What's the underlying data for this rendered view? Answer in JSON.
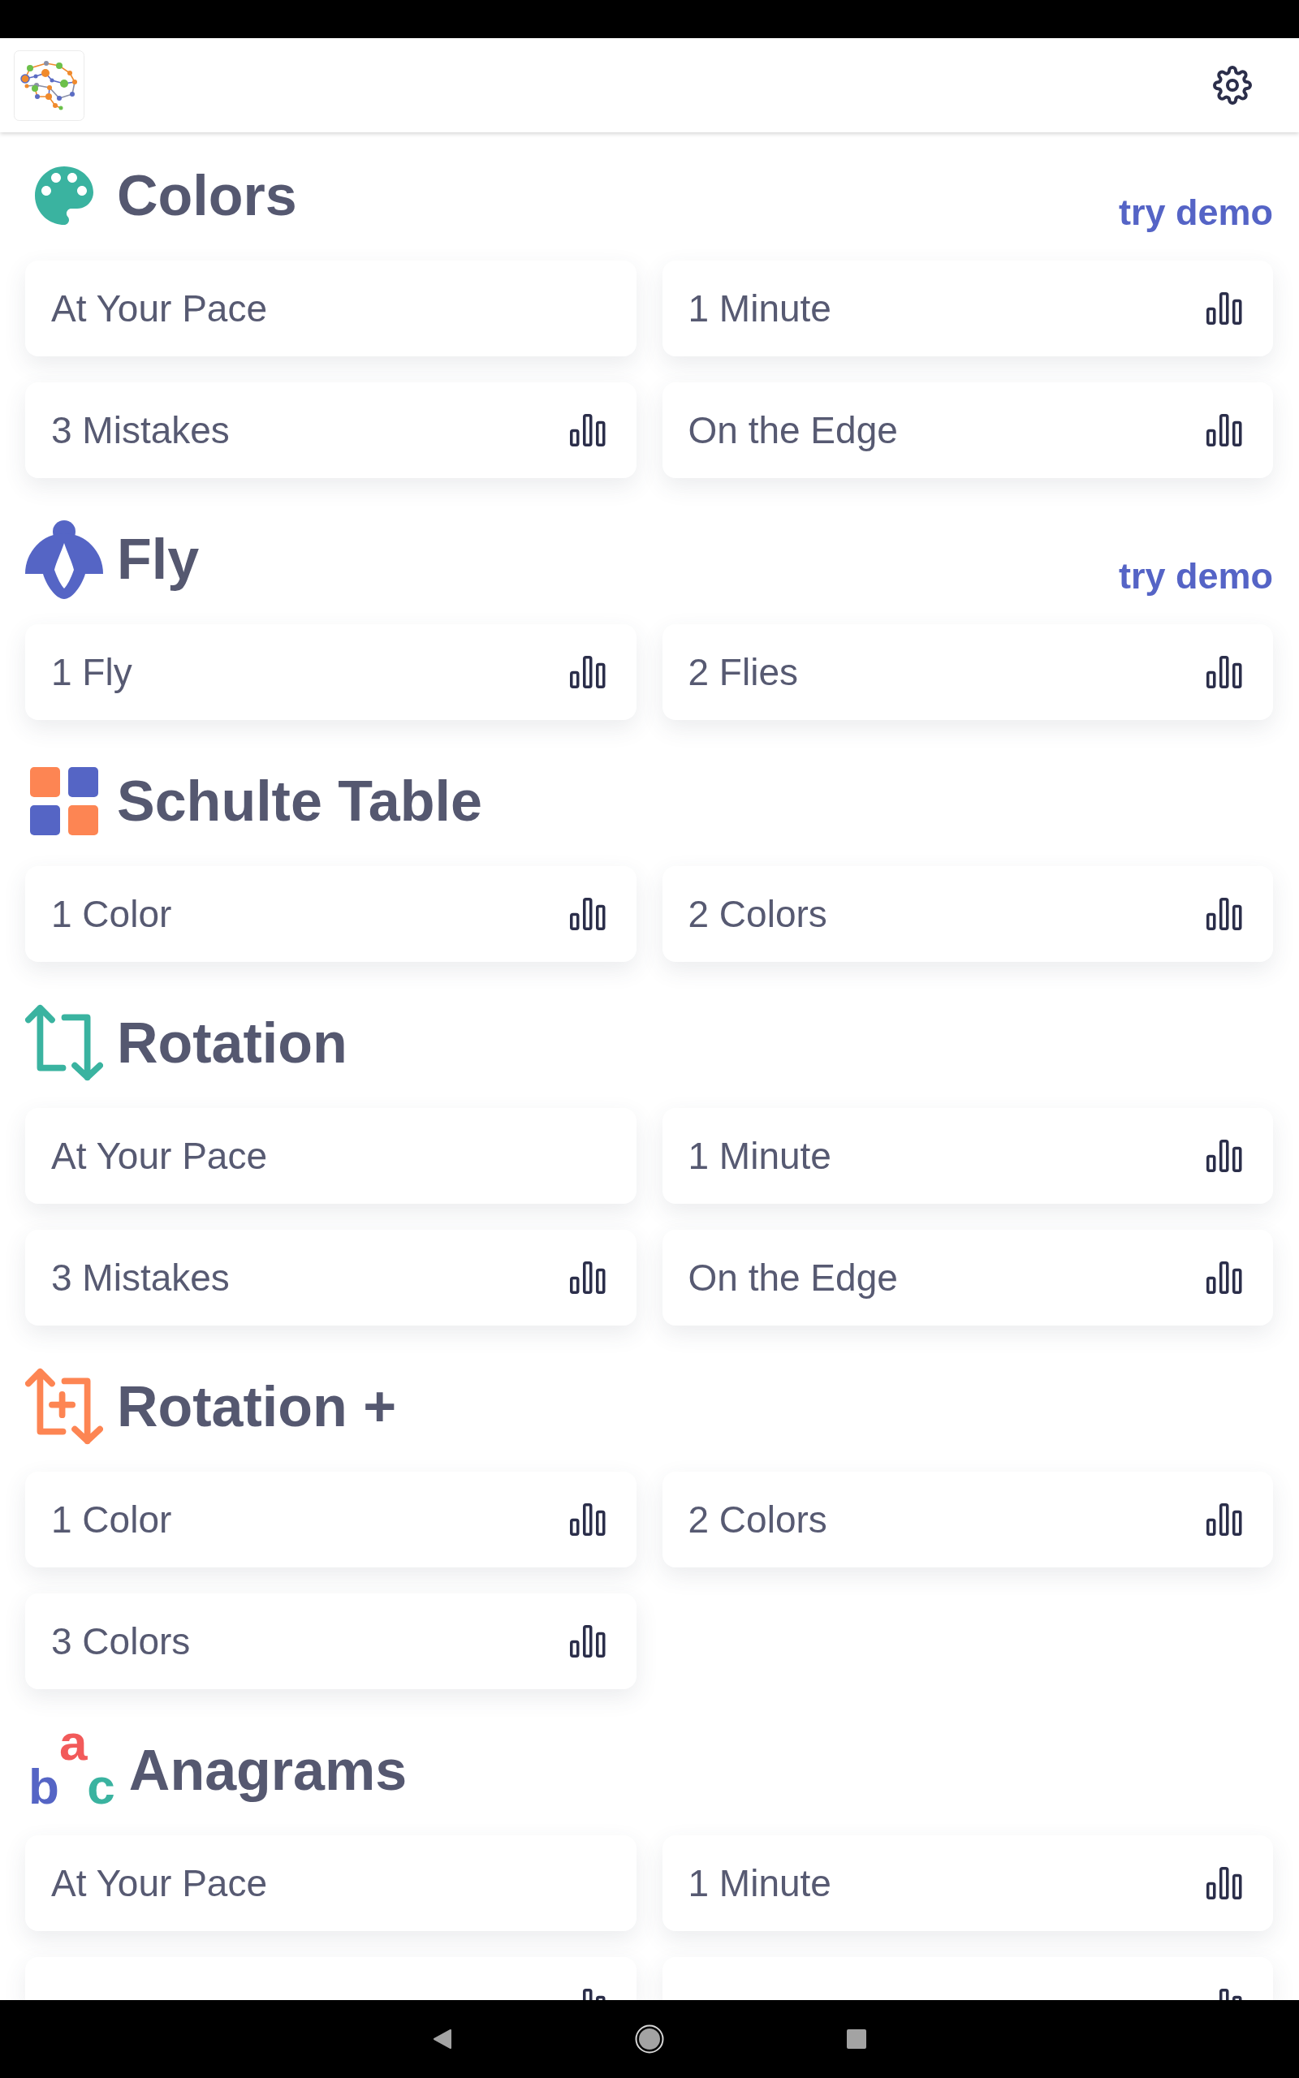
{
  "sections": [
    {
      "kind": "colors",
      "title": "Colors",
      "demo_link": "try demo",
      "modes": [
        {
          "label": "At Your Pace",
          "stats": false
        },
        {
          "label": "1 Minute",
          "stats": true
        },
        {
          "label": "3 Mistakes",
          "stats": true
        },
        {
          "label": "On the Edge",
          "stats": true
        }
      ]
    },
    {
      "kind": "fly",
      "title": "Fly",
      "demo_link": "try demo",
      "modes": [
        {
          "label": "1 Fly",
          "stats": true
        },
        {
          "label": "2 Flies",
          "stats": true
        }
      ]
    },
    {
      "kind": "schulte",
      "title": "Schulte Table",
      "modes": [
        {
          "label": "1 Color",
          "stats": true
        },
        {
          "label": "2 Colors",
          "stats": true
        }
      ]
    },
    {
      "kind": "rotation",
      "title": "Rotation",
      "modes": [
        {
          "label": "At Your Pace",
          "stats": false
        },
        {
          "label": "1 Minute",
          "stats": true
        },
        {
          "label": "3 Mistakes",
          "stats": true
        },
        {
          "label": "On the Edge",
          "stats": true
        }
      ]
    },
    {
      "kind": "rotationplus",
      "title": "Rotation +",
      "modes": [
        {
          "label": "1 Color",
          "stats": true
        },
        {
          "label": "2 Colors",
          "stats": true
        },
        {
          "label": "3 Colors",
          "stats": true
        }
      ]
    },
    {
      "kind": "anagrams",
      "title": "Anagrams",
      "icon_letters": [
        {
          "text": "b",
          "color": "#5565c5"
        },
        {
          "text": "a",
          "color": "#f25a5a"
        },
        {
          "text": "c",
          "color": "#3ab3a0"
        }
      ],
      "modes": [
        {
          "label": "At Your Pace",
          "stats": false
        },
        {
          "label": "1 Minute",
          "stats": true
        },
        {
          "stats": true
        },
        {
          "stats": true
        }
      ]
    }
  ]
}
